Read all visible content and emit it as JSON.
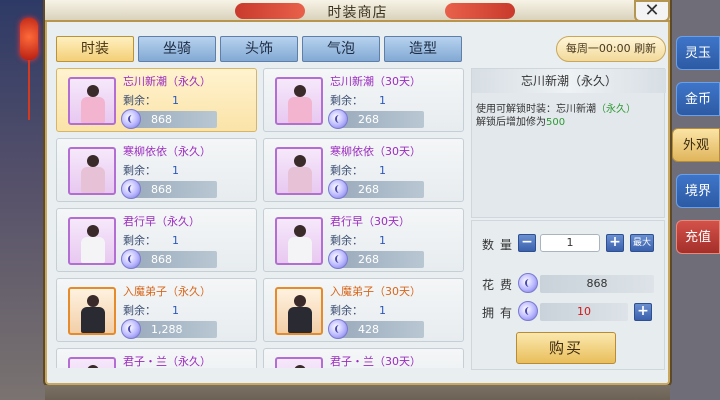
{
  "window": {
    "title": "时装商店",
    "close_label": "✕"
  },
  "tabs": [
    {
      "label": "时装",
      "active": true
    },
    {
      "label": "坐骑",
      "active": false
    },
    {
      "label": "头饰",
      "active": false
    },
    {
      "label": "气泡",
      "active": false
    },
    {
      "label": "造型",
      "active": false
    }
  ],
  "refresh": {
    "label": "每周一00:00 刷新"
  },
  "items": [
    {
      "name": "忘川新潮（永久）",
      "remain_label": "剩余：",
      "remain": "1",
      "price": "868",
      "quality": "purple",
      "selected": true
    },
    {
      "name": "忘川新潮（30天）",
      "remain_label": "剩余：",
      "remain": "1",
      "price": "268",
      "quality": "purple",
      "selected": false
    },
    {
      "name": "寒柳依依（永久）",
      "remain_label": "剩余：",
      "remain": "1",
      "price": "868",
      "quality": "purple",
      "selected": false
    },
    {
      "name": "寒柳依依（30天）",
      "remain_label": "剩余：",
      "remain": "1",
      "price": "268",
      "quality": "purple",
      "selected": false
    },
    {
      "name": "君行早（永久）",
      "remain_label": "剩余：",
      "remain": "1",
      "price": "868",
      "quality": "purple",
      "selected": false
    },
    {
      "name": "君行早（30天）",
      "remain_label": "剩余：",
      "remain": "1",
      "price": "268",
      "quality": "purple",
      "selected": false
    },
    {
      "name": "入魔弟子（永久）",
      "remain_label": "剩余：",
      "remain": "1",
      "price": "1,288",
      "quality": "orange",
      "selected": false
    },
    {
      "name": "入魔弟子（30天）",
      "remain_label": "剩余：",
      "remain": "1",
      "price": "428",
      "quality": "orange",
      "selected": false
    },
    {
      "name": "君子・兰（永久）",
      "quality": "purple",
      "selected": false
    },
    {
      "name": "君子・兰（30天）",
      "quality": "purple",
      "selected": false
    }
  ],
  "detail": {
    "title": "忘川新潮（永久）",
    "desc_prefix": "使用可解锁时装：忘川新潮",
    "desc_item": "（永久）",
    "desc_line2_prefix": "解锁后增加修为",
    "desc_line2_value": "500"
  },
  "purchase": {
    "qty_label": "数量",
    "qty_value": "1",
    "minus_label": "−",
    "plus_label": "+",
    "max_label": "最大",
    "cost_label": "花费",
    "cost_value": "868",
    "own_label": "拥有",
    "own_value": "10",
    "own_add_label": "+",
    "buy_label": "购买"
  },
  "side_tabs": [
    {
      "label": "灵玉",
      "style": "blue",
      "active": false
    },
    {
      "label": "金币",
      "style": "blue",
      "active": false
    },
    {
      "label": "外观",
      "style": "gold",
      "active": true
    },
    {
      "label": "境界",
      "style": "blue",
      "active": false
    },
    {
      "label": "充值",
      "style": "red",
      "active": false
    }
  ],
  "colors": {
    "accent": "#f3cf78",
    "tab_blue": "#82a9d3",
    "quality_purple": "#9b2ac0",
    "quality_orange": "#d8661a",
    "own_red": "#d01818"
  }
}
